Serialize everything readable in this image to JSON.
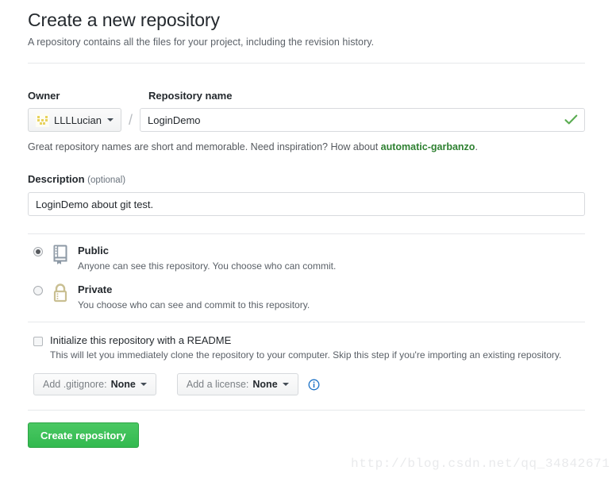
{
  "header": {
    "title": "Create a new repository",
    "subtitle": "A repository contains all the files for your project, including the revision history."
  },
  "owner": {
    "label": "Owner",
    "name": "LLLLucian",
    "separator": "/",
    "avatar_icon": "identicon-avatar",
    "caret_icon": "chevron-down-icon"
  },
  "repo_name": {
    "label": "Repository name",
    "value": "LoginDemo",
    "placeholder": "",
    "valid_icon": "check-icon",
    "hint_prefix": "Great repository names are short and memorable. Need inspiration? How about ",
    "hint_link": "automatic-garbanzo",
    "hint_suffix": "."
  },
  "description": {
    "label": "Description",
    "optional": "(optional)",
    "value": "LoginDemo about git test.",
    "placeholder": ""
  },
  "visibility": {
    "options": [
      {
        "title": "Public",
        "description": "Anyone can see this repository. You choose who can commit.",
        "icon": "repo-book-icon",
        "selected": true
      },
      {
        "title": "Private",
        "description": "You choose who can see and commit to this repository.",
        "icon": "lock-icon",
        "selected": false
      }
    ]
  },
  "readme": {
    "title": "Initialize this repository with a README",
    "description": "This will let you immediately clone the repository to your computer. Skip this step if you're importing an existing repository.",
    "checked": false
  },
  "gitignore": {
    "prefix": "Add .gitignore:",
    "value": "None",
    "caret_icon": "chevron-down-icon"
  },
  "license": {
    "prefix": "Add a license:",
    "value": "None",
    "caret_icon": "chevron-down-icon",
    "info_icon": "info-circle-icon"
  },
  "submit": {
    "label": "Create repository"
  },
  "watermark": {
    "text": "http://blog.csdn.net/qq_34842671"
  },
  "colors": {
    "accent_green": "#2f8132",
    "button_green": "#32b94f",
    "check_green": "#5aac51",
    "link_green": "#2f8132",
    "info_blue": "#1b71c6",
    "lock_tan": "#c9bf92",
    "repo_gray": "#7f8a95"
  }
}
